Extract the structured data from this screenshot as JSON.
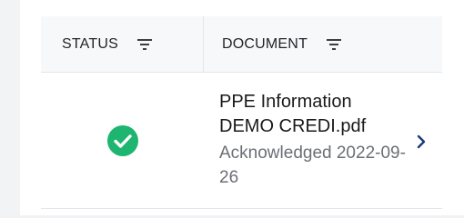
{
  "table": {
    "columns": [
      {
        "label": "STATUS"
      },
      {
        "label": "DOCUMENT"
      }
    ],
    "rows": [
      {
        "status_icon": "check-circle-icon",
        "status_color": "#1db56f",
        "document_name": "PPE Information DEMO CREDI.pdf",
        "document_status": "Acknowledged 2022-09-26"
      }
    ]
  },
  "colors": {
    "accent": "#1a3a7a",
    "success": "#1db56f"
  }
}
